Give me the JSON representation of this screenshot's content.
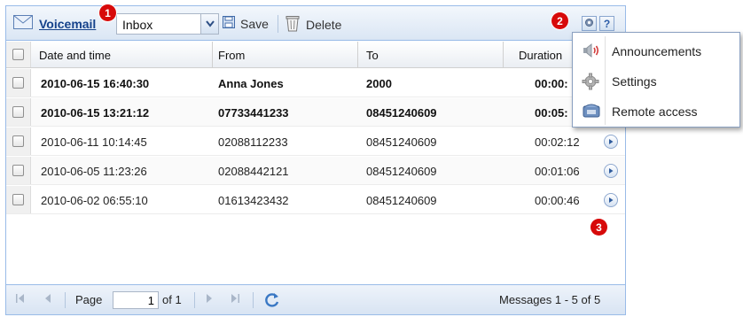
{
  "toolbar": {
    "title": "Voicemail",
    "folder_value": "Inbox",
    "save_label": "Save",
    "delete_label": "Delete",
    "help_label": "?"
  },
  "badges": {
    "one": "1",
    "two": "2",
    "three": "3"
  },
  "columns": {
    "date": "Date and time",
    "from": "From",
    "to": "To",
    "duration": "Duration"
  },
  "rows": [
    {
      "date": "2010-06-15 16:40:30",
      "from": "Anna Jones",
      "to": "2000",
      "duration": "00:00:",
      "unread": true
    },
    {
      "date": "2010-06-15 13:21:12",
      "from": "07733441233",
      "to": "08451240609",
      "duration": "00:05:",
      "unread": true
    },
    {
      "date": "2010-06-11 10:14:45",
      "from": "02088112233",
      "to": "08451240609",
      "duration": "00:02:12",
      "unread": false
    },
    {
      "date": "2010-06-05 11:23:26",
      "from": "02088442121",
      "to": "08451240609",
      "duration": "00:01:06",
      "unread": false
    },
    {
      "date": "2010-06-02 06:55:10",
      "from": "01613423432",
      "to": "08451240609",
      "duration": "00:00:46",
      "unread": false
    }
  ],
  "menu": {
    "items": [
      {
        "label": "Announcements",
        "icon": "speaker-icon"
      },
      {
        "label": "Settings",
        "icon": "gear-icon"
      },
      {
        "label": "Remote access",
        "icon": "phone-icon"
      }
    ]
  },
  "pager": {
    "page_label": "Page",
    "page_value": "1",
    "of_label": "of 1",
    "summary": "Messages 1 - 5 of 5"
  }
}
